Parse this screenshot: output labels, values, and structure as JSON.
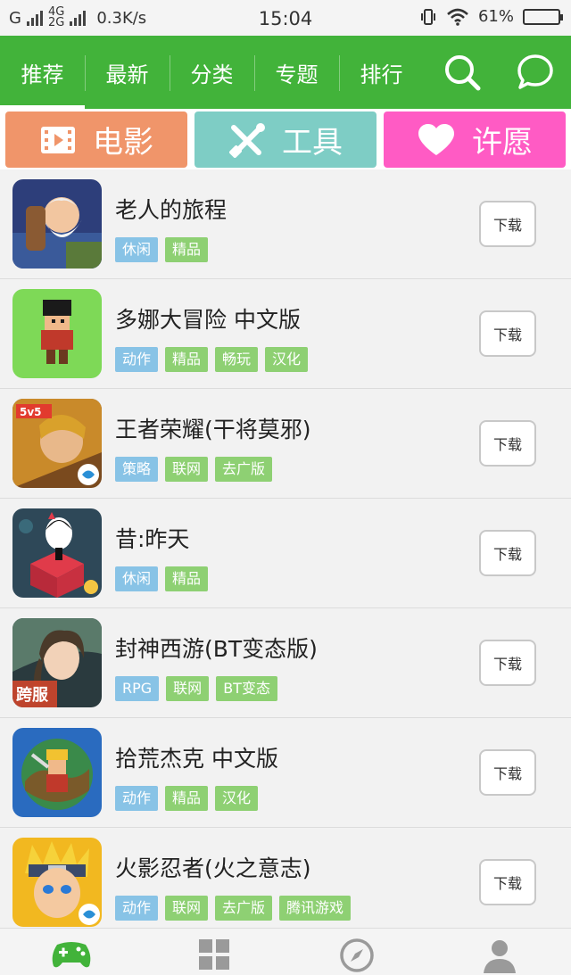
{
  "status_bar": {
    "carrier1": "G",
    "net_top": "4G",
    "net_bottom": "2G",
    "speed": "0.3K/s",
    "time": "15:04",
    "battery": "61%",
    "battery_level": 0.61
  },
  "top_nav": {
    "tabs": [
      {
        "label": "推荐",
        "active": true
      },
      {
        "label": "最新",
        "active": false
      },
      {
        "label": "分类",
        "active": false
      },
      {
        "label": "专题",
        "active": false
      },
      {
        "label": "排行",
        "active": false
      }
    ],
    "icons": [
      "search-icon",
      "chat-bubble-icon"
    ]
  },
  "categories": [
    {
      "label": "电影",
      "icon": "film-icon",
      "color": "#f0956a"
    },
    {
      "label": "工具",
      "icon": "tools-icon",
      "color": "#7ecdc5"
    },
    {
      "label": "许愿",
      "icon": "heart-icon",
      "color": "#ff5bc4"
    }
  ],
  "download_label": "下载",
  "apps": [
    {
      "title": "老人的旅程",
      "icon": "old-man-journey-icon",
      "tags": [
        {
          "t": "休闲",
          "c": "blue"
        },
        {
          "t": "精品",
          "c": "green"
        }
      ]
    },
    {
      "title": "多娜大冒险 中文版",
      "icon": "pixel-adventure-icon",
      "tags": [
        {
          "t": "动作",
          "c": "blue"
        },
        {
          "t": "精品",
          "c": "green"
        },
        {
          "t": "畅玩",
          "c": "green"
        },
        {
          "t": "汉化",
          "c": "green"
        }
      ]
    },
    {
      "title": "王者荣耀(干将莫邪)",
      "icon": "honor-of-kings-icon",
      "tags": [
        {
          "t": "策略",
          "c": "blue"
        },
        {
          "t": "联网",
          "c": "green"
        },
        {
          "t": "去广版",
          "c": "green"
        }
      ]
    },
    {
      "title": "昔:昨天",
      "icon": "yesterday-game-icon",
      "tags": [
        {
          "t": "休闲",
          "c": "blue"
        },
        {
          "t": "精品",
          "c": "green"
        }
      ]
    },
    {
      "title": "封神西游(BT变态版)",
      "icon": "fengshen-xiyou-icon",
      "tags": [
        {
          "t": "RPG",
          "c": "blue"
        },
        {
          "t": "联网",
          "c": "green"
        },
        {
          "t": "BT变态",
          "c": "green"
        }
      ]
    },
    {
      "title": "拾荒杰克 中文版",
      "icon": "scavenger-jack-icon",
      "tags": [
        {
          "t": "动作",
          "c": "blue"
        },
        {
          "t": "精品",
          "c": "green"
        },
        {
          "t": "汉化",
          "c": "green"
        }
      ]
    },
    {
      "title": "火影忍者(火之意志)",
      "icon": "naruto-icon",
      "tags": [
        {
          "t": "动作",
          "c": "blue"
        },
        {
          "t": "联网",
          "c": "green"
        },
        {
          "t": "去广版",
          "c": "green"
        },
        {
          "t": "腾讯游戏",
          "c": "green"
        }
      ]
    }
  ],
  "bottom_nav": {
    "items": [
      {
        "icon": "gamepad-icon",
        "active": true
      },
      {
        "icon": "apps-grid-icon",
        "active": false
      },
      {
        "icon": "compass-icon",
        "active": false
      },
      {
        "icon": "user-icon",
        "active": false
      }
    ]
  },
  "colors": {
    "brand_green": "#42b33a",
    "tag_blue": "#88c3e6",
    "tag_green": "#8ed073"
  }
}
